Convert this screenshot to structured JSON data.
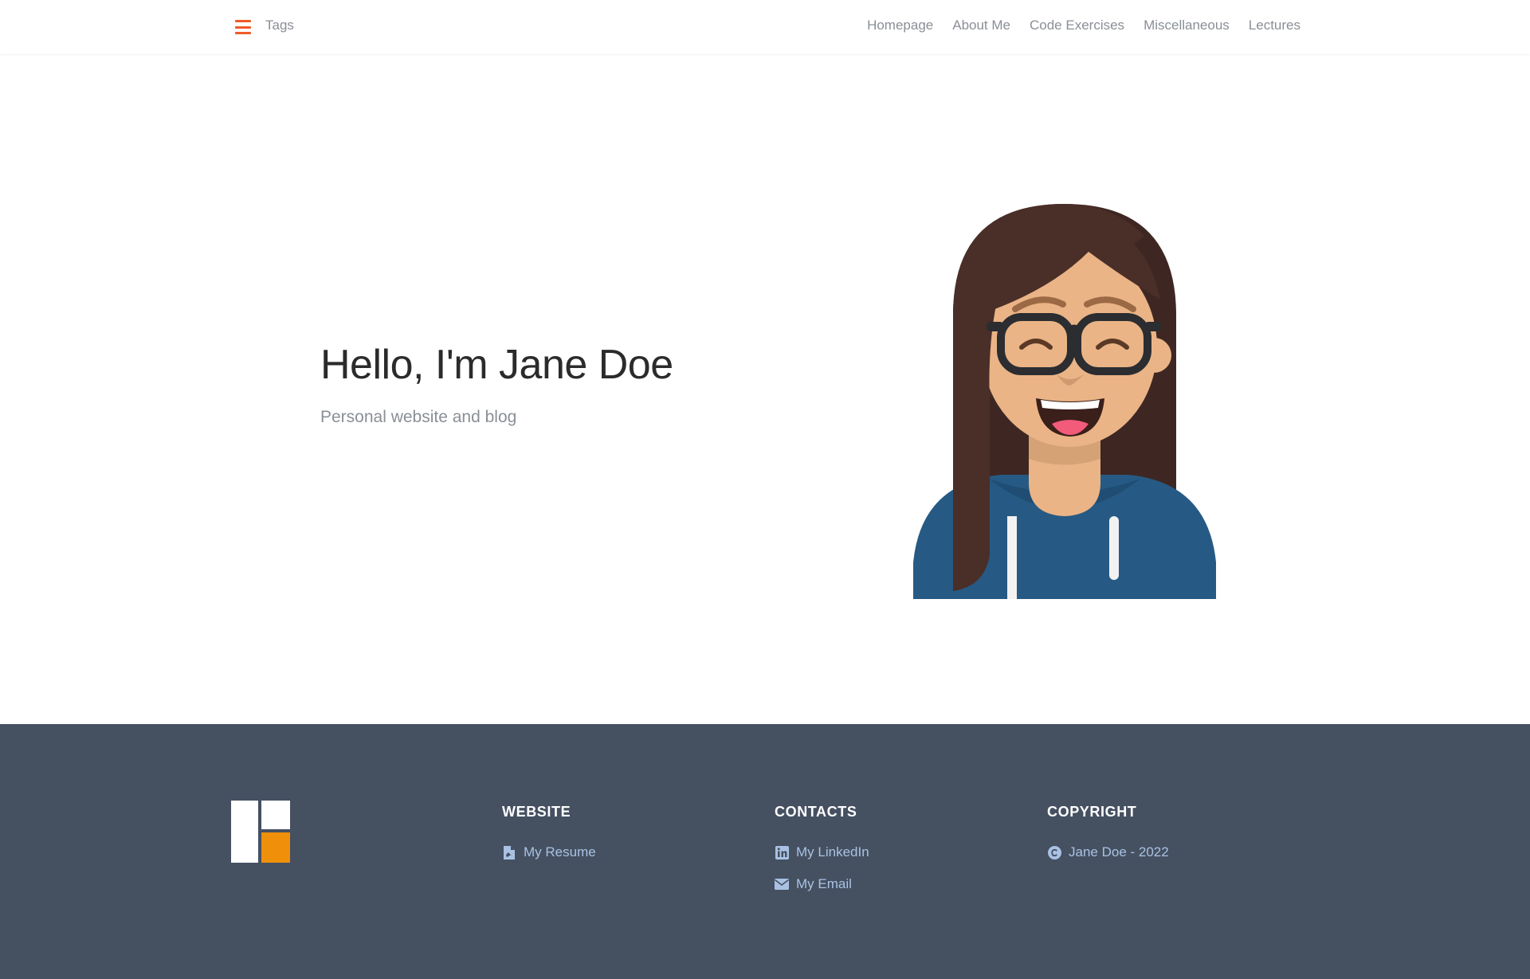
{
  "nav": {
    "tags_label": "Tags",
    "links": [
      {
        "label": "Homepage"
      },
      {
        "label": "About Me"
      },
      {
        "label": "Code Exercises"
      },
      {
        "label": "Miscellaneous"
      },
      {
        "label": "Lectures"
      }
    ],
    "menu_icon": "hamburger-icon",
    "accent_color": "#f05a28"
  },
  "hero": {
    "title": "Hello, I'm Jane Doe",
    "subtitle": "Personal website and blog",
    "image": "cartoon-avatar-girl-with-glasses"
  },
  "footer": {
    "background_color": "#455061",
    "logo": "site-logo",
    "website": {
      "heading": "WEBSITE",
      "links": [
        {
          "label": "My Resume",
          "icon": "pdf-file-icon"
        }
      ]
    },
    "contacts": {
      "heading": "CONTACTS",
      "links": [
        {
          "label": "My LinkedIn",
          "icon": "linkedin-icon"
        },
        {
          "label": "My Email",
          "icon": "envelope-icon"
        }
      ]
    },
    "copyright": {
      "heading": "COPYRIGHT",
      "links": [
        {
          "label": "Jane Doe - 2022",
          "icon": "copyright-icon"
        }
      ]
    }
  }
}
